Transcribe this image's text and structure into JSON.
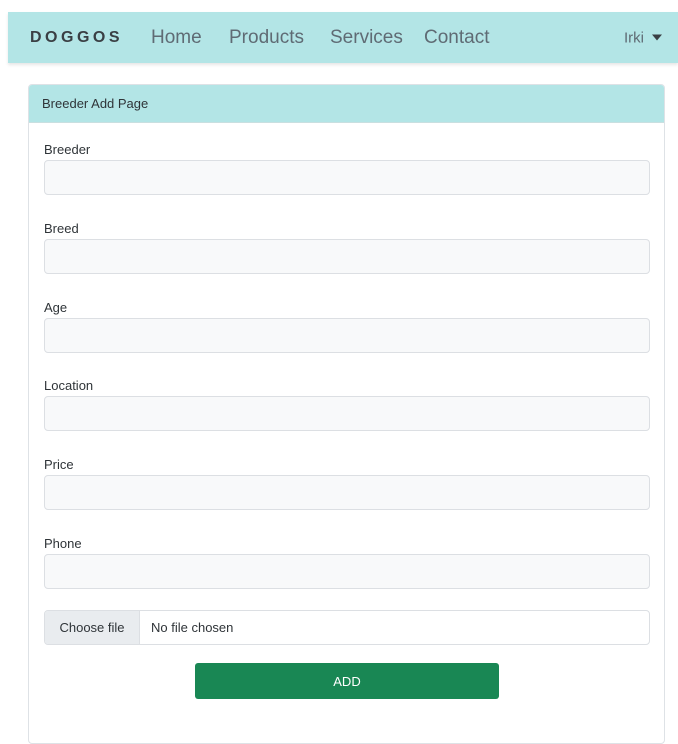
{
  "navbar": {
    "brand": "DOGGOS",
    "links": [
      {
        "label": "Home"
      },
      {
        "label": "Products"
      },
      {
        "label": "Services"
      },
      {
        "label": "Contact"
      }
    ],
    "user": {
      "name": "Irki",
      "icon": "caret-down-icon"
    }
  },
  "form": {
    "header": "Breeder Add Page",
    "fields": [
      {
        "label": "Breeder",
        "value": ""
      },
      {
        "label": "Breed",
        "value": ""
      },
      {
        "label": "Age",
        "value": ""
      },
      {
        "label": "Location",
        "value": ""
      },
      {
        "label": "Price",
        "value": ""
      },
      {
        "label": "Phone",
        "value": ""
      }
    ],
    "file": {
      "button_label": "Choose file",
      "status": "No file chosen"
    },
    "submit_label": "ADD"
  },
  "colors": {
    "nav_background": "#b3e5e6",
    "header_background": "#b3e5e6",
    "submit_button": "#198754"
  }
}
